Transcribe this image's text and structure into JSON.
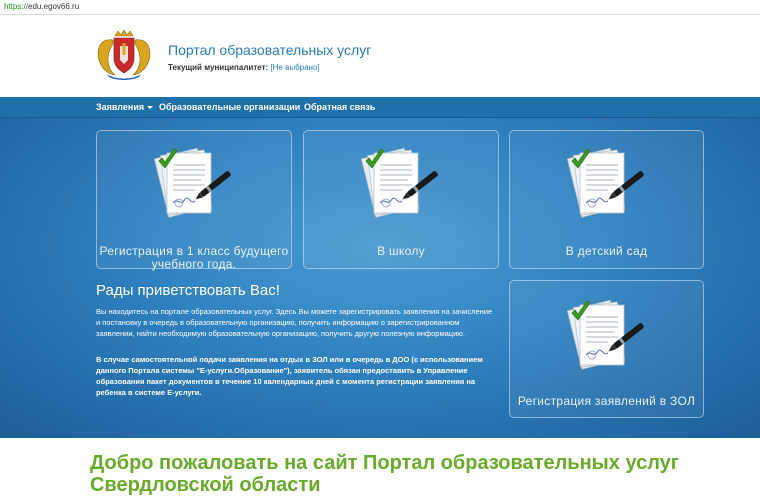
{
  "browser": {
    "url": "https://edu.egov66.ru",
    "url_scheme": "https://",
    "url_host": "edu.egov66.ru"
  },
  "header": {
    "title": "Портал образовательных услуг",
    "municipality_label": "Текущий муниципалитет:",
    "municipality_value": "[Не выбрано]"
  },
  "nav": {
    "items": [
      {
        "label": "Заявления",
        "has_dropdown": true
      },
      {
        "label": "Образовательные организации"
      },
      {
        "label": "Обратная связь"
      }
    ]
  },
  "tiles": [
    {
      "label": "Регистрация в 1 класс будущего учебного года.",
      "icon": "documents-pen-icon"
    },
    {
      "label": "В школу",
      "icon": "documents-pen-icon"
    },
    {
      "label": "В детский сад",
      "icon": "documents-pen-icon"
    },
    {
      "label": "Регистрация заявлений в ЗОЛ",
      "icon": "documents-pen-icon"
    }
  ],
  "welcome": {
    "title": "Рады приветствовать Вас!",
    "text": "Вы находитесь на портале образовательных услуг. Здесь Вы можете зарегистрировать заявления на зачисление и постановку в очередь в образовательную организацию, получить информацию о зарегистрированном заявлении, найти необходимую образовательную организацию, получить другую полезную информацию.",
    "note": "В случае самостоятельной подачи заявления на отдых в ЗОЛ или в очередь в ДОО (с использованием данного Портала системы \"Е-услуги.Образование\"), заявитель обязан предоставить в Управление образования пакет документов в течение 10 календарных дней с момента регистрации заявления на ребенка в системе Е-услуги."
  },
  "greeting": "Добро пожаловать на сайт Портал образовательных услуг Свердловской области",
  "colors": {
    "nav_bg": "#1f6fa8",
    "hero_bg": "#2f80bf",
    "title_blue": "#2a7ab8",
    "greeting_green": "#6aaa2a",
    "check_green": "#3a9a1f"
  }
}
